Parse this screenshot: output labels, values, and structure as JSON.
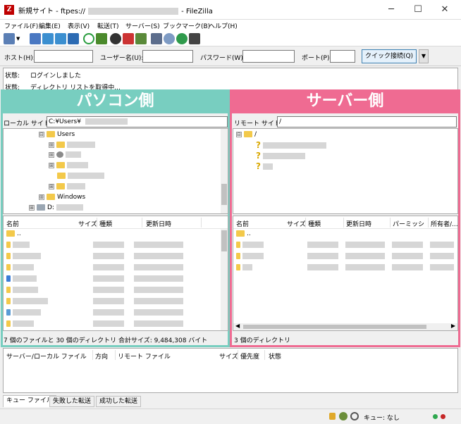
{
  "window": {
    "title": "新規サイト - ftpes://",
    "title_suffix": "- FileZilla",
    "app_icon": "Z",
    "controls": {
      "minimize": "─",
      "maximize": "☐",
      "close": "✕"
    }
  },
  "menu": [
    "ファイル(F)",
    "編集(E)",
    "表示(V)",
    "転送(T)",
    "サーバー(S)",
    "ブックマーク(B)",
    "ヘルプ(H)"
  ],
  "quickconnect": {
    "host_label": "ホスト(H):",
    "user_label": "ユーザー名(U):",
    "pass_label": "パスワード(W):",
    "port_label": "ポート(P):",
    "connect_label": "クイック接続(Q)",
    "dropdown": "▼"
  },
  "log": [
    {
      "label": "状態:",
      "text": "ログインしました"
    },
    {
      "label": "状態:",
      "text": "ディレクトリ リストを取得中..."
    }
  ],
  "local": {
    "banner": "パソコン側",
    "site_label": "ローカル サイト:",
    "site_path": "C:¥Users¥",
    "tree": [
      {
        "label": "Users",
        "expander": "⊟",
        "level": 0
      },
      {
        "label": "",
        "expander": "⊞",
        "level": 1
      },
      {
        "label": "",
        "expander": "⊞",
        "level": 1
      },
      {
        "label": "",
        "expander": "⊞",
        "level": 1
      },
      {
        "label": "",
        "expander": "",
        "level": 1
      },
      {
        "label": "",
        "expander": "⊞",
        "level": 1
      },
      {
        "label": "Windows",
        "expander": "⊞",
        "level": 0
      },
      {
        "label": "D:",
        "expander": "⊞",
        "level": -1
      }
    ],
    "columns": [
      "名前",
      "サイズ",
      "種類",
      "更新日時"
    ],
    "parent_row": "..",
    "status": "7 個のファイルと 30 個のディレクトリ 合計サイズ: 9,484,308 バイト"
  },
  "remote": {
    "banner": "サーバー側",
    "site_label": "リモート サイト:",
    "site_path": "/",
    "tree_root": "/",
    "question_mark": "?",
    "columns": [
      "名前",
      "サイズ",
      "種類",
      "更新日時",
      "パーミッシ",
      "所有者/..."
    ],
    "parent_row": "..",
    "status": "3 個のディレクトリ"
  },
  "queue": {
    "columns": [
      "サーバー/ローカル ファイル",
      "方向",
      "リモート ファイル",
      "サイズ",
      "優先度",
      "状態"
    ]
  },
  "tabs": [
    "キュー ファイル",
    "失敗した転送",
    "成功した転送"
  ],
  "statusbar": {
    "queue_text": "キュー: なし"
  },
  "colors": {
    "local_accent": "#78cec0",
    "remote_accent": "#ef6b92"
  }
}
